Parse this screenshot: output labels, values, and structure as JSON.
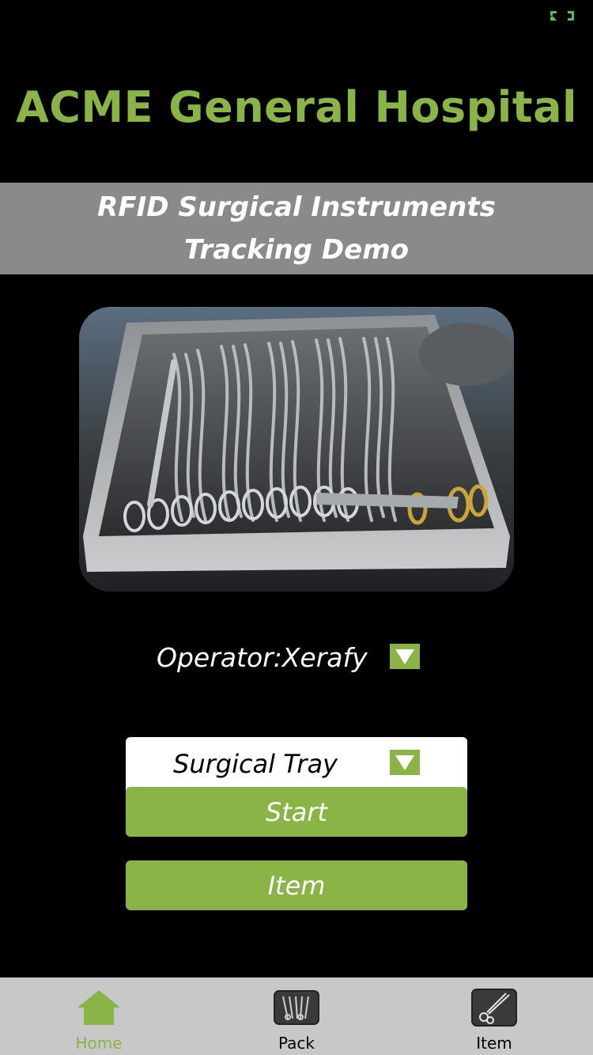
{
  "app": {
    "title": "ACME General Hospital",
    "subtitle_line1": "RFID Surgical Instruments",
    "subtitle_line2": "Tracking Demo"
  },
  "hero": {
    "image_alt": "surgical-instrument-tray-photo"
  },
  "operator": {
    "label": "Operator:Xerafy"
  },
  "tray": {
    "selected": "Surgical Tray"
  },
  "buttons": {
    "start": "Start",
    "item": "Item"
  },
  "tabs": [
    {
      "label": "Home",
      "icon": "home-icon",
      "active": true
    },
    {
      "label": "Pack",
      "icon": "pack-icon",
      "active": false
    },
    {
      "label": "Item",
      "icon": "item-icon",
      "active": false
    }
  ],
  "colors": {
    "accent": "#8ab446",
    "background": "#000000",
    "band": "#8a8a8a",
    "tabbar": "#c8c8c8"
  }
}
